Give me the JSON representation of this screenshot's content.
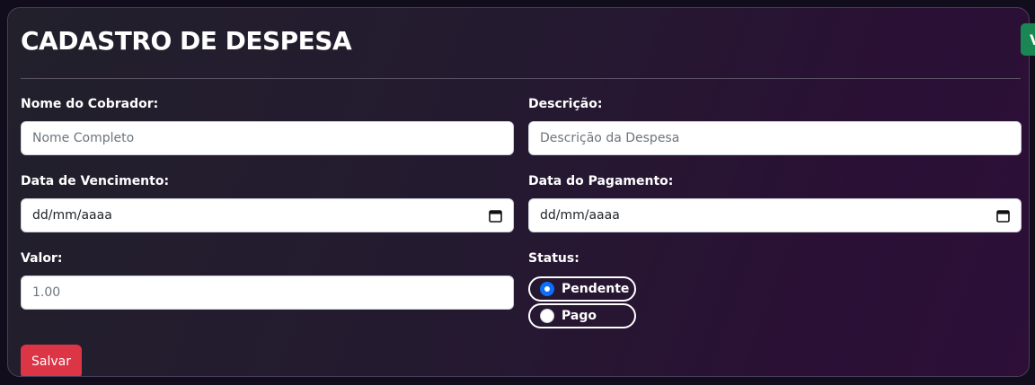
{
  "form": {
    "title": "CADASTRO DE DESPESA",
    "nome_label": "Nome do Cobrador:",
    "nome_placeholder": "Nome Completo",
    "descricao_label": "Descrição:",
    "descricao_placeholder": "Descrição da Despesa",
    "vencimento_label": "Data de Vencimento:",
    "vencimento_value": "dd/mm/aaaa",
    "pagamento_label": "Data do Pagamento:",
    "pagamento_value": "dd/mm/aaaa",
    "valor_label": "Valor:",
    "valor_placeholder": "1.00",
    "status_label": "Status:",
    "status_options": [
      {
        "label": "Pendente",
        "checked": true
      },
      {
        "label": "Pago",
        "checked": false
      }
    ],
    "save_label": "Salvar"
  },
  "corner_button": {
    "label": "V"
  },
  "colors": {
    "save": "#dc3545",
    "corner": "#198754",
    "radio_checked": "#0d6efd"
  },
  "icons": {
    "date": "calendar-icon"
  }
}
